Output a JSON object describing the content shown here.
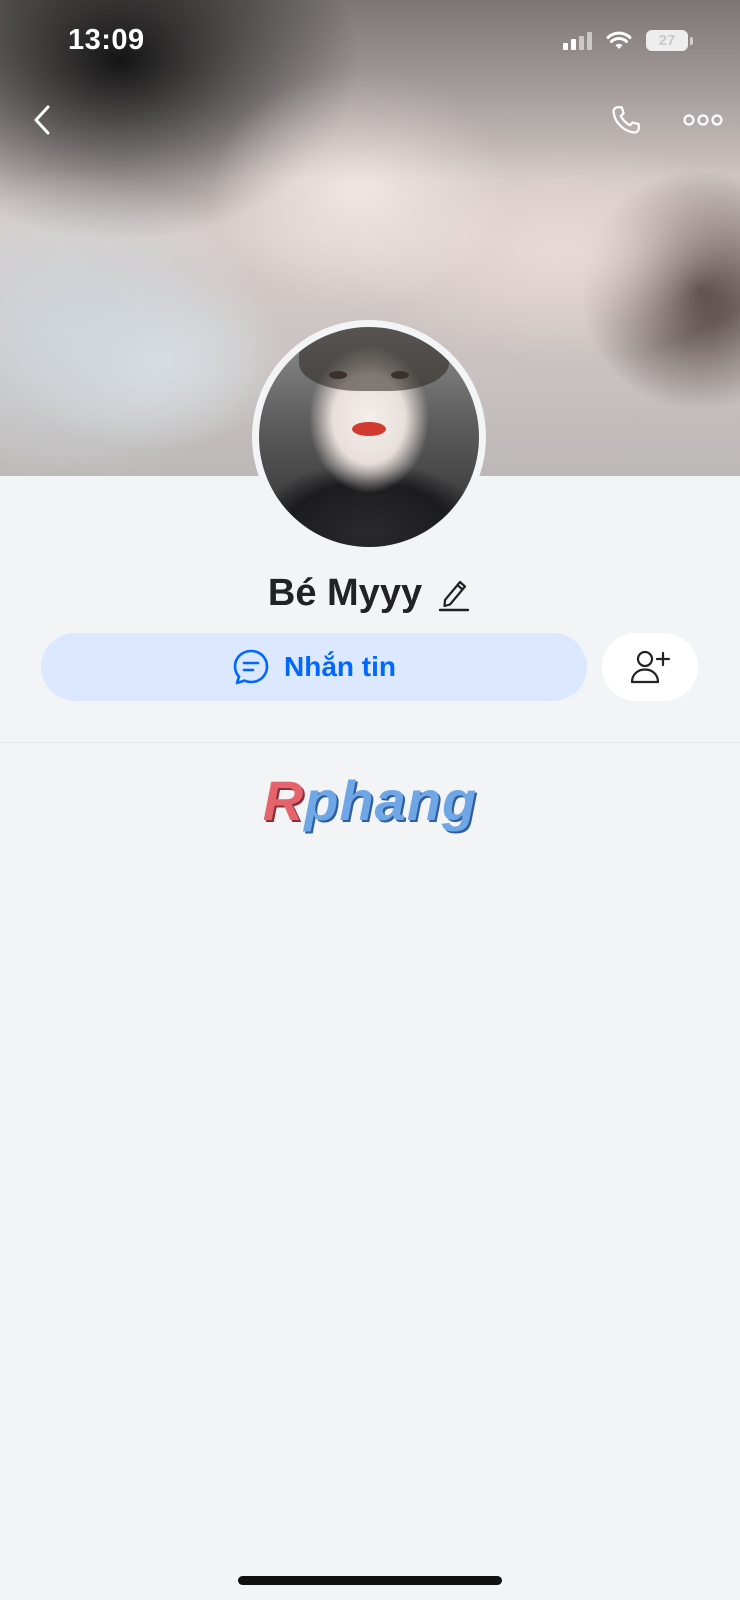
{
  "status_bar": {
    "time": "13:09",
    "battery": "27",
    "signal_icon": "signal-icon",
    "wifi_icon": "wifi-icon"
  },
  "nav": {
    "back_icon": "chevron-left-icon",
    "call_icon": "phone-icon",
    "more_icon": "more-horizontal-icon"
  },
  "profile": {
    "name": "Bé Myyy",
    "edit_icon": "pencil-icon"
  },
  "actions": {
    "message_label": "Nhắn tin",
    "message_icon": "chat-bubble-icon",
    "add_friend_icon": "add-user-icon"
  },
  "watermark": {
    "first_letter": "R",
    "rest": "phang"
  },
  "colors": {
    "accent": "#0068ff",
    "message_button_bg": "#dbe8ff",
    "page_bg": "#f3f4f6"
  }
}
